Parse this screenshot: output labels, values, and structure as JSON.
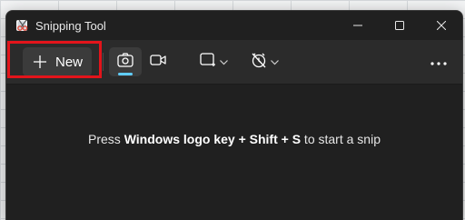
{
  "window": {
    "title": "Snipping Tool",
    "app_icon": "snipping-tool-icon"
  },
  "titlebar_buttons": {
    "minimize_icon": "minimize-icon",
    "maximize_icon": "maximize-icon",
    "close_icon": "close-icon"
  },
  "toolbar": {
    "new_label": "New",
    "new_icon": "plus-icon",
    "modes": [
      {
        "icon": "camera-icon",
        "active": true
      },
      {
        "icon": "video-camera-icon",
        "active": false
      }
    ],
    "shape_dropdown_icon": "rectangle-snip-icon",
    "delay_dropdown_icon": "no-timer-icon",
    "more_icon": "more-icon"
  },
  "content": {
    "hint_prefix": "Press ",
    "hint_keys": "Windows logo key + Shift + S",
    "hint_suffix": " to start a snip"
  },
  "colors": {
    "accent": "#60cdff",
    "highlight": "#e3141b",
    "window_bg": "#202020",
    "toolbar_bg": "#2b2b2b"
  }
}
